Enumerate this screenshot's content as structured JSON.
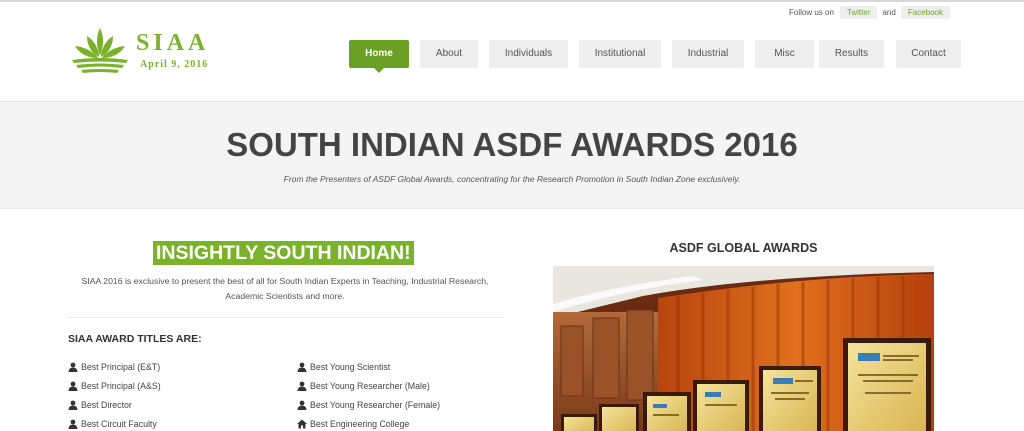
{
  "social": {
    "follow_label": "Follow us on",
    "twitter_label": "Twitter",
    "and_label": "and",
    "facebook_label": "Facebook"
  },
  "logo": {
    "name": "SIAA",
    "date": "April 9, 2016",
    "icon": "leaf-logo-icon",
    "color": "#7ab22b"
  },
  "nav": {
    "items": [
      {
        "label": "Home",
        "active": true
      },
      {
        "label": "About"
      },
      {
        "label": "Individuals"
      },
      {
        "label": "Institutional"
      },
      {
        "label": "Industrial"
      },
      {
        "label": "Misc"
      },
      {
        "label": "Results"
      },
      {
        "label": "Contact"
      }
    ],
    "active_color": "#6aa024"
  },
  "hero": {
    "title": "SOUTH INDIAN ASDF AWARDS 2016",
    "subtitle": "From the Presenters of ASDF Global Awards, concentrating for the Research Promotion in South Indian Zone exclusively."
  },
  "main": {
    "tagline": "INSIGHTLY SOUTH INDIAN!",
    "intro": "SIAA 2016 is exclusive to present the best of all for South Indian Experts in Teaching, Industrial Research, Academic Scientists and more.",
    "titles_heading": "SIAA AWARD TITLES ARE:",
    "awards_left": [
      {
        "label": "Best Principal (E&T)",
        "icon": "user-icon"
      },
      {
        "label": "Best Principal (A&S)",
        "icon": "user-icon"
      },
      {
        "label": "Best Director",
        "icon": "user-icon"
      },
      {
        "label": "Best Circuit Faculty",
        "icon": "user-icon"
      }
    ],
    "awards_right": [
      {
        "label": "Best Young Scientist",
        "icon": "user-icon"
      },
      {
        "label": "Best Young Researcher (Male)",
        "icon": "user-icon"
      },
      {
        "label": "Best Young Researcher (Female)",
        "icon": "user-icon"
      },
      {
        "label": "Best Engineering College",
        "icon": "home-icon"
      }
    ]
  },
  "side": {
    "heading": "ASDF GLOBAL AWARDS"
  }
}
